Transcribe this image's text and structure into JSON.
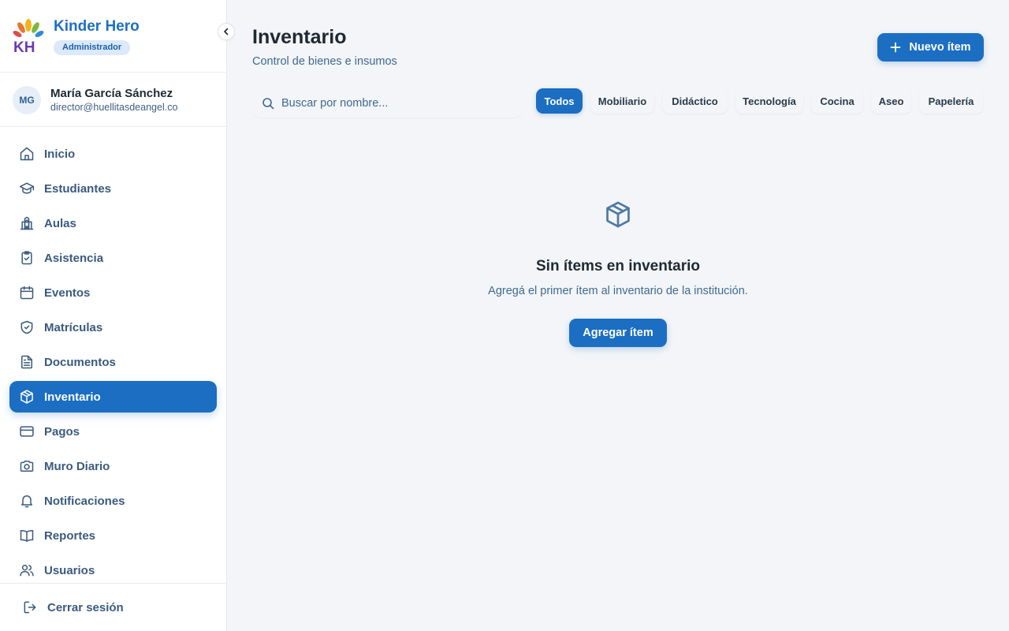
{
  "brand": {
    "name": "Kinder Hero",
    "role": "Administrador",
    "logo_letters": "KH"
  },
  "user": {
    "initials": "MG",
    "name": "María García Sánchez",
    "email": "director@huellitasdeangel.co"
  },
  "nav": {
    "items": [
      {
        "label": "Inicio",
        "icon": "home-icon"
      },
      {
        "label": "Estudiantes",
        "icon": "graduation-cap-icon"
      },
      {
        "label": "Aulas",
        "icon": "school-building-icon"
      },
      {
        "label": "Asistencia",
        "icon": "clipboard-check-icon"
      },
      {
        "label": "Eventos",
        "icon": "calendar-icon"
      },
      {
        "label": "Matrículas",
        "icon": "shield-check-icon"
      },
      {
        "label": "Documentos",
        "icon": "document-icon"
      },
      {
        "label": "Inventario",
        "icon": "package-icon",
        "active": true
      },
      {
        "label": "Pagos",
        "icon": "credit-card-icon"
      },
      {
        "label": "Muro Diario",
        "icon": "camera-icon"
      },
      {
        "label": "Notificaciones",
        "icon": "bell-icon"
      },
      {
        "label": "Reportes",
        "icon": "book-icon"
      },
      {
        "label": "Usuarios",
        "icon": "users-icon"
      }
    ],
    "logout": "Cerrar sesión"
  },
  "header": {
    "title": "Inventario",
    "subtitle": "Control de bienes e insumos",
    "new_button": "Nuevo ítem"
  },
  "search": {
    "placeholder": "Buscar por nombre...",
    "value": ""
  },
  "filters": {
    "selected": "Todos",
    "chips": [
      "Todos",
      "Mobiliario",
      "Didáctico",
      "Tecnología",
      "Cocina",
      "Aseo",
      "Papelería"
    ]
  },
  "empty_state": {
    "icon": "package-icon",
    "title": "Sin ítems en inventario",
    "text": "Agregá el primer ítem al inventario de la institución.",
    "button": "Agregar ítem"
  },
  "colors": {
    "primary": "#1b6ec2",
    "text_muted": "#3f6a92",
    "background": "#f3f5f8",
    "sidebar": "#ffffff"
  }
}
